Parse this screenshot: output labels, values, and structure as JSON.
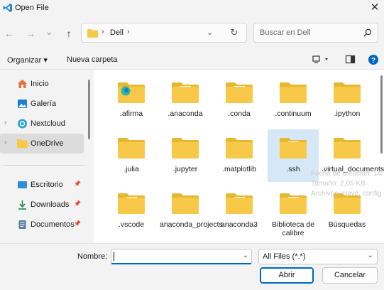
{
  "window": {
    "title": "Open File",
    "close_glyph": "✕"
  },
  "nav": {
    "back_glyph": "←",
    "forward_glyph": "→",
    "recent_glyph": "⌄",
    "up_glyph": "↑",
    "breadcrumb": [
      "Dell"
    ],
    "sep_glyph": "›",
    "dropdown_glyph": "⌄",
    "refresh_glyph": "↻",
    "search_placeholder": "Buscar en Dell"
  },
  "toolbar": {
    "organize": "Organizar ▾",
    "new_folder": "Nueva carpeta"
  },
  "sidebar": {
    "items": [
      {
        "label": "Inicio",
        "icon": "home-icon",
        "chevron": ""
      },
      {
        "label": "Galería",
        "icon": "gallery-icon",
        "chevron": ""
      },
      {
        "label": "Nextcloud",
        "icon": "nextcloud-icon",
        "chevron": "›"
      },
      {
        "label": "OneDrive",
        "icon": "folder-icon",
        "chevron": "›"
      },
      {
        "label": "Escritorio",
        "icon": "desktop-icon",
        "pin": "📌"
      },
      {
        "label": "Downloads",
        "icon": "download-icon",
        "pin": "📌"
      },
      {
        "label": "Documentos",
        "icon": "documents-icon",
        "pin": "📌"
      }
    ]
  },
  "files": [
    {
      "name": ".afirma",
      "variant": "edge"
    },
    {
      "name": ".anaconda",
      "variant": "doc"
    },
    {
      "name": ".conda",
      "variant": "doc"
    },
    {
      "name": ".continuum",
      "variant": "plain"
    },
    {
      "name": ".ipython",
      "variant": "plain"
    },
    {
      "name": ".julia",
      "variant": "plain"
    },
    {
      "name": ".jupyter",
      "variant": "plain"
    },
    {
      "name": ".matplotlib",
      "variant": "plain"
    },
    {
      "name": ".ssh",
      "variant": "doc"
    },
    {
      "name": ".virtual_documents",
      "variant": "plain"
    },
    {
      "name": ".vscode",
      "variant": "img"
    },
    {
      "name": "anaconda_projects",
      "variant": "plain"
    },
    {
      "name": "anaconda3",
      "variant": "doc"
    },
    {
      "name": "Biblioteca de calibre",
      "variant": "doc"
    },
    {
      "name": "Búsquedas",
      "variant": "plain"
    }
  ],
  "tooltip": {
    "lines": [
      "Fecha de creación: 14/",
      "Tamaño: 2,05 KB",
      "Archivos: clave, config"
    ]
  },
  "footer": {
    "name_label": "Nombre:",
    "name_value": "",
    "filter_value": "All Files (*.*)",
    "open_button": "Abrir",
    "cancel_button": "Cancelar"
  },
  "colors": {
    "accent": "#0067c0",
    "folder": "#f8c948",
    "selection": "#d6e8f7"
  }
}
